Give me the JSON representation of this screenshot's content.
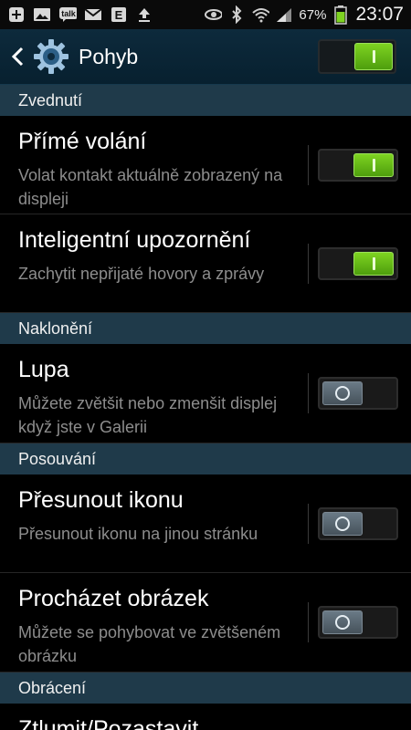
{
  "statusbar": {
    "left_icons": [
      "add-icon",
      "image-icon",
      "talk-icon",
      "gmail-icon",
      "e-icon",
      "upload-icon"
    ],
    "talk_label": "talk",
    "e_label": "E",
    "battery_percent": "67%",
    "time": "23:07"
  },
  "actionbar": {
    "title": "Pohyb",
    "master_switch_on": true
  },
  "sections": [
    {
      "label": "Zvednutí"
    },
    {
      "label": "Naklonění"
    },
    {
      "label": "Posouvání"
    },
    {
      "label": "Obrácení"
    }
  ],
  "items": [
    {
      "title": "Přímé volání",
      "subtitle": "Volat kontakt aktuálně zobrazený na displeji",
      "on": true
    },
    {
      "title": "Inteligentní upozornění",
      "subtitle": "Zachytit nepřijaté hovory a zprávy",
      "on": true
    },
    {
      "title": "Lupa",
      "subtitle": "Můžete zvětšit nebo zmenšit displej když jste v Galerii",
      "on": false
    },
    {
      "title": "Přesunout ikonu",
      "subtitle": "Přesunout ikonu na jinou stránku",
      "on": false
    },
    {
      "title": "Procházet obrázek",
      "subtitle": "Můžete se pohybovat ve zvětšeném obrázku",
      "on": false
    },
    {
      "title": "Ztlumit/Pozastavit",
      "subtitle": "",
      "on": false
    }
  ],
  "colors": {
    "accent_on": "#7ed321",
    "section_bg": "#1f3a4a",
    "actionbar_bg": "#0d2a3c"
  }
}
